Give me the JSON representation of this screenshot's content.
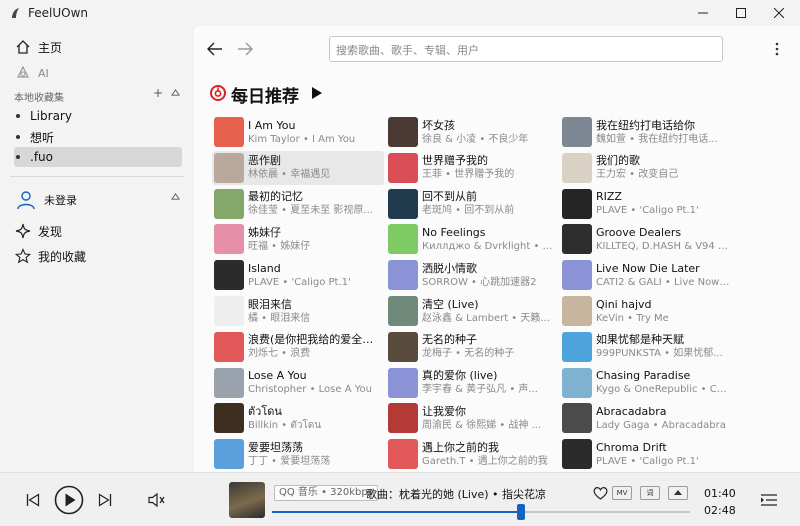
{
  "window": {
    "title": "FeelUOwn"
  },
  "sidebar": {
    "home": "主页",
    "ai": "AI",
    "local_section": "本地收藏集",
    "collections": [
      {
        "label": "Library",
        "active": false
      },
      {
        "label": "想听",
        "active": false
      },
      {
        "label": ".fuo",
        "active": true
      }
    ],
    "user_label": "未登录",
    "discover": "发现",
    "my_favorites": "我的收藏"
  },
  "main": {
    "search_placeholder": "搜索歌曲、歌手、专辑、用户",
    "daily_title": "每日推荐"
  },
  "songs": [
    {
      "title": "I Am You",
      "sub": "Kim Taylor • I Am You",
      "cover": "#e7614f"
    },
    {
      "title": "坏女孩",
      "sub": "徐良 & 小凌 • 不良少年",
      "cover": "#4a3a33"
    },
    {
      "title": "我在纽约打电话给你",
      "sub": "魏如萱 • 我在纽约打电话...",
      "cover": "#7d8794"
    },
    {
      "title": "恶作剧",
      "sub": "林依晨 • 幸福遇见",
      "cover": "#b9a99c",
      "highlight": true
    },
    {
      "title": "世界赠予我的",
      "sub": "王菲 • 世界赠予我的",
      "cover": "#d94e57"
    },
    {
      "title": "我们的歌",
      "sub": "王力宏 • 改变自己",
      "cover": "#d9d2c4"
    },
    {
      "title": "最初的记忆",
      "sub": "徐佳莹 • 夏至未至 影视原...",
      "cover": "#84a86a"
    },
    {
      "title": "回不到从前",
      "sub": "老斑鸠 • 回不到从前",
      "cover": "#1f3b4d"
    },
    {
      "title": "RIZZ",
      "sub": "PLAVE • 'Caligo Pt.1'",
      "cover": "#252525"
    },
    {
      "title": "姊妹仔",
      "sub": "旺福 • 姊妹仔",
      "cover": "#e68fa8"
    },
    {
      "title": "No Feelings",
      "sub": "Киллджо & Dvrklight • No...",
      "cover": "#7ecb63"
    },
    {
      "title": "Groove Dealers",
      "sub": "KILLTEQ, D.HASH & V94 • ...",
      "cover": "#2e2e2e"
    },
    {
      "title": "Island",
      "sub": "PLAVE • 'Caligo Pt.1'",
      "cover": "#2b2b2b"
    },
    {
      "title": "洒脱小情歌",
      "sub": "SORROW • 心跳加速器2",
      "cover": "#8b93d6"
    },
    {
      "title": "Live Now Die Later",
      "sub": "CATI2 & GALI • Live Now ...",
      "cover": "#8b93d6"
    },
    {
      "title": "眼泪来信",
      "sub": "橘 • 眼泪来信",
      "cover": "#eeeeee"
    },
    {
      "title": "清空 (Live)",
      "sub": "赵泳鑫 & Lambert • 天籁...",
      "cover": "#6f8a7a"
    },
    {
      "title": "Qini hajvd",
      "sub": "KeVin • Try Me",
      "cover": "#c7b59d"
    },
    {
      "title": "浪费(是你把我给的爱全都...",
      "sub": "刘烁七 • 浪费",
      "cover": "#e25858"
    },
    {
      "title": "无名的种子",
      "sub": "龙梅子 • 无名的种子",
      "cover": "#5a4c3d"
    },
    {
      "title": "如果忧郁是种天赋",
      "sub": "999PUNKSTA • 如果忧郁...",
      "cover": "#4fa3dc"
    },
    {
      "title": "Lose A You",
      "sub": "Christopher • Lose A You",
      "cover": "#9aa3ad"
    },
    {
      "title": "真的爱你 (live)",
      "sub": "李宇春 & 黄子弘凡 • 声...",
      "cover": "#8b93d6"
    },
    {
      "title": "Chasing Paradise",
      "sub": "Kygo & OneRepublic • Ca...",
      "cover": "#7fb2d1"
    },
    {
      "title": "ตัวโดน",
      "sub": "Billkin • ตัวโดน",
      "cover": "#3d2e1f"
    },
    {
      "title": "让我爱你",
      "sub": "周渝民 & 徐熙娣 • 战神 ...",
      "cover": "#b33a36"
    },
    {
      "title": "Abracadabra",
      "sub": "Lady Gaga • Abracadabra",
      "cover": "#4b4b4b"
    },
    {
      "title": "爱要坦荡荡",
      "sub": "丁丁 • 爱要坦荡荡",
      "cover": "#5aa0dc"
    },
    {
      "title": "遇上你之前的我",
      "sub": "Gareth.T • 遇上你之前的我",
      "cover": "#e25858"
    },
    {
      "title": "Chroma Drift",
      "sub": "PLAVE • 'Caligo Pt.1'",
      "cover": "#2b2b2b"
    }
  ],
  "player": {
    "quality": "QQ 音乐 • 320kbps",
    "now_playing": "歌曲：枕着光的她 (Live) • 指尖花凉",
    "mv": "MV",
    "lyric": "词",
    "current_time": "01:40",
    "total_time": "02:48",
    "progress": 0.595
  },
  "colors": {
    "accent": "#1565c0",
    "brand_red": "#e02020"
  }
}
